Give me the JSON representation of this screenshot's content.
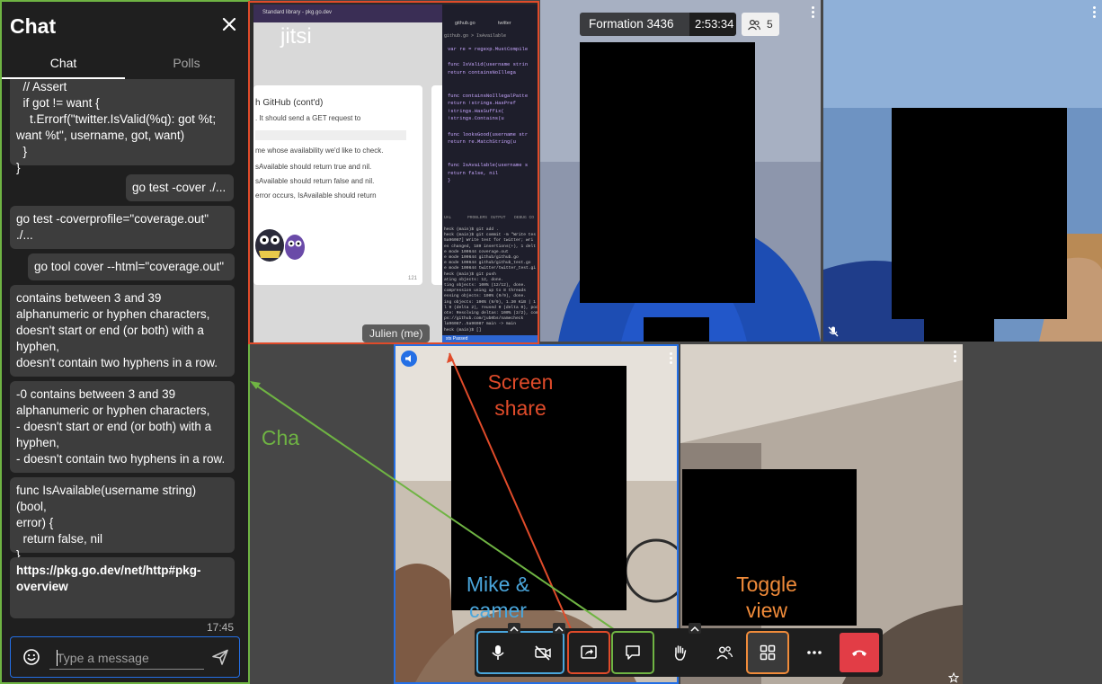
{
  "chat": {
    "title": "Chat",
    "tabs": [
      "Chat",
      "Polls"
    ],
    "messages": [
      {
        "text": "  // Assert\n  if got != want {\n    t.Errorf(\"twitter.IsValid(%q): got %t;\nwant %t\", username, got, want)\n  }\n}",
        "local": false
      },
      {
        "text": "go test -cover ./...",
        "local": true
      },
      {
        "text": "go test -coverprofile=\"coverage.out\"\n./...",
        "local": false
      },
      {
        "text": "go tool cover --html=\"coverage.out\"",
        "local": true
      },
      {
        "text": "contains between 3 and 39\nalphanumeric or hyphen characters,\ndoesn't start or end (or both) with a\nhyphen,\ndoesn't contain two hyphens in a row.",
        "local": false
      },
      {
        "text": "-0 contains between 3 and 39\nalphanumeric or hyphen characters,\n- doesn't start or end (or both) with a\nhyphen,\n- doesn't contain two hyphens in a row.",
        "local": false
      },
      {
        "text": "func IsAvailable(username string) (bool,\nerror) {\n  return false, nil\n}",
        "local": false
      },
      {
        "text": "https://pkg.go.dev/net/http#pkg-\noverview",
        "local": false,
        "bold": true
      }
    ],
    "last_time": "17:45",
    "input_placeholder": "Type a message"
  },
  "conference": {
    "title": "Formation 3436",
    "timer": "2:53:34",
    "participant_count": "5"
  },
  "share": {
    "browser_tabs": [
      "Standard library - pkg.go.dev",
      "github.go"
    ],
    "logo": "jitsi",
    "slide_title": "h GitHub (cont'd)",
    "slide_lines": [
      ". It should send a GET request to",
      "me whose availability we'd like to check.",
      "sAvailable should return true and nil.",
      "sAvailable should return false and nil.",
      "error occurs, IsAvailable should return"
    ],
    "slide_number": "121",
    "participant_name": "Julien (me)",
    "editor_tabs": [
      "github.go",
      "twitter"
    ],
    "editor_breadcrumb": "github.go > IsAvailable",
    "code_lines": [
      "var re = regexp.MustCompile",
      "",
      "func IsValid(username strin",
      "    return containsNoIllega",
      "",
      "",
      "func containsNoIllegalPatte",
      "    return !strings.HasPref",
      "        !strings.HasSuffix(",
      "        !strings.Contains(u",
      "",
      "func looksGood(username str",
      "    return re.MatchString(u",
      "",
      "",
      "func IsAvailable(username s",
      "    return false, nil",
      "}"
    ],
    "terminal_tabs": [
      "UAL",
      "PROBLEMS",
      "OUTPUT",
      "DEBUG CO"
    ],
    "terminal_lines": [
      "heck (main)$ git add .",
      "heck (main)$ git commit -m \"Write tes",
      "5a96087] Write test for twitter; wri",
      "es changed, 189 insertions(+), 1 delt",
      "e mode 100644 coverage.out",
      "e mode 100644 github/github.go",
      "e mode 100644 github/github_test.go",
      "e mode 100644 twitter/twitter_test.gi",
      "heck (main)$ git push",
      "ating objects: 12, done.",
      "ting objects: 100% (12/12), done.",
      "compression using up to 8 threads",
      "essing objects: 100% (9/9), done.",
      "ing objects: 100% (9/9), 1.30 KiB | 1",
      "l 9 (delta 2), reused 0 (delta 0), poc",
      "ote: Resolving deltas: 100% (2/2), comp",
      "ps://github.com/jub0bs/namecheck",
      "la96087..5a96087  main -> main",
      "heck (main)$ []"
    ],
    "status_bar": "sts Passed"
  },
  "annotations": {
    "screen_share": "Screen\nshare",
    "chat": "Cha",
    "mike_camera": "Mike &\ncamer",
    "toggle_view": "Toggle\nview",
    "colors": {
      "red": "#e04b2a",
      "green": "#6fb443",
      "blue": "#4aa6dc",
      "orange": "#f08b3a"
    }
  },
  "toolbar": {
    "buttons": [
      "microphone-icon",
      "camera-off-icon",
      "screen-share-icon",
      "chat-icon",
      "raise-hand-icon",
      "participants-icon",
      "tile-view-icon",
      "more-icon",
      "hangup-icon"
    ]
  }
}
